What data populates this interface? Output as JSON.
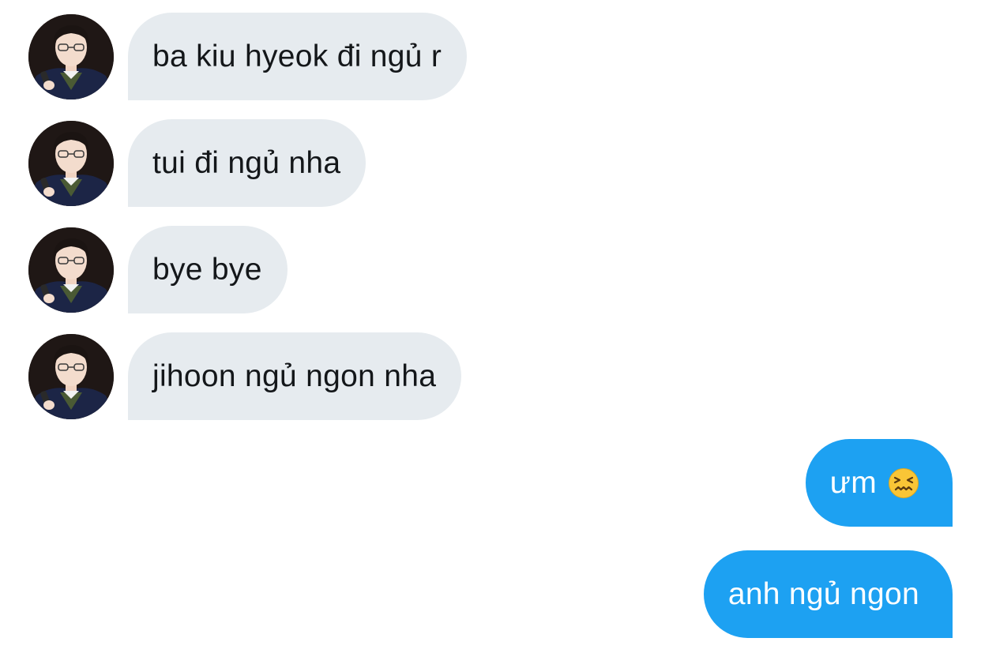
{
  "conversation": {
    "incoming": [
      {
        "text": "ba kiu hyeok đi ngủ r",
        "avatar_icon": "user-avatar-icon"
      },
      {
        "text": "tui đi ngủ nha",
        "avatar_icon": "user-avatar-icon"
      },
      {
        "text": "bye bye",
        "avatar_icon": "user-avatar-icon"
      },
      {
        "text": "jihoon ngủ ngon nha",
        "avatar_icon": "user-avatar-icon"
      }
    ],
    "outgoing": [
      {
        "text": "ưm",
        "emoji": "confounded-face-icon"
      },
      {
        "text": "anh ngủ ngon"
      }
    ]
  },
  "colors": {
    "incoming_bubble": "#e6ebef",
    "incoming_text": "#14171a",
    "outgoing_bubble": "#1da1f2",
    "outgoing_text": "#ffffff",
    "background": "#ffffff"
  }
}
